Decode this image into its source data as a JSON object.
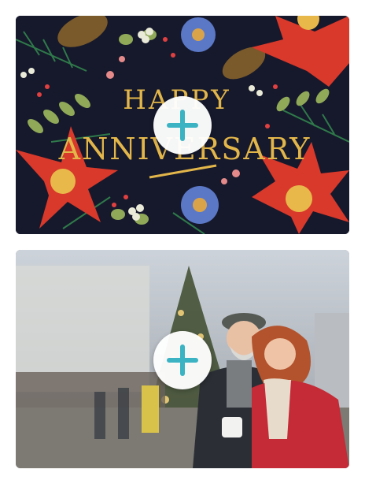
{
  "cards": [
    {
      "card_text": [
        "HAPPY",
        "ANNIVERSARY"
      ],
      "add_icon": "plus-icon"
    },
    {
      "add_icon": "plus-icon"
    }
  ],
  "colors": {
    "plus": "#3bb3c3",
    "button_bg": "#ffffff",
    "card_text_gold": "#e3b64a",
    "poinsettia_red": "#d8392b"
  }
}
